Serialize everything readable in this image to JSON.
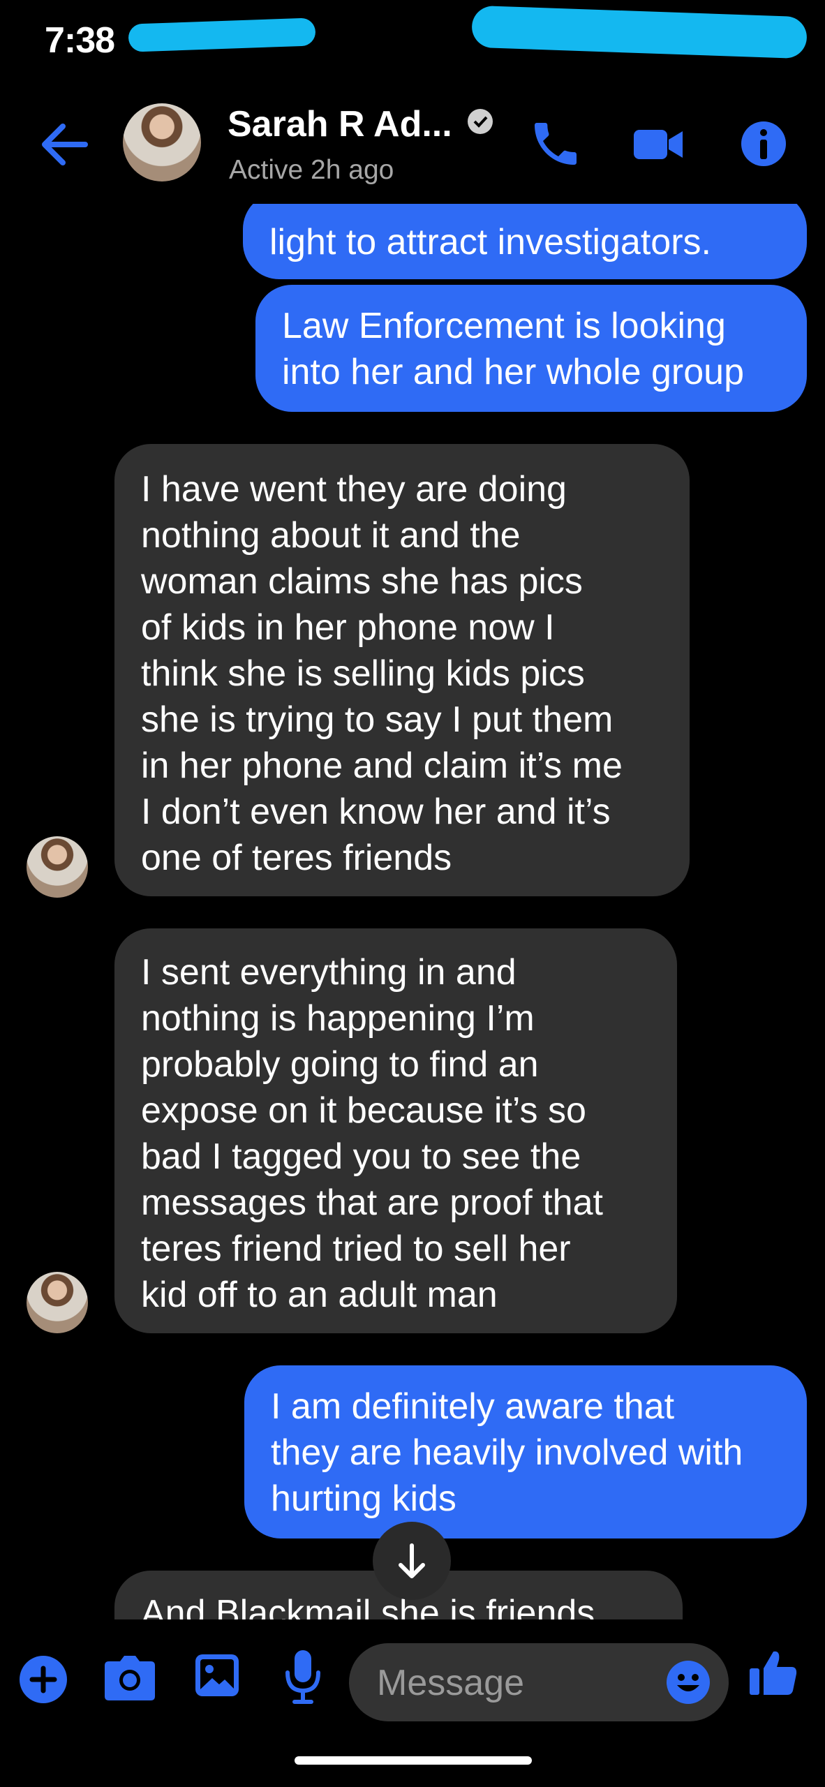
{
  "status_bar": {
    "time": "7:38"
  },
  "header": {
    "contact_name": "Sarah R Ad...",
    "status": "Active 2h ago",
    "accent_color": "#2f6bf5"
  },
  "messages": [
    {
      "from": "me",
      "lines": [
        "light to attract investigators."
      ]
    },
    {
      "from": "me",
      "lines": [
        "Law Enforcement is looking",
        "into her and her whole group"
      ]
    },
    {
      "from": "them",
      "lines": [
        "I have went they are doing",
        "nothing about it and the",
        "woman claims she has pics",
        "of kids in her phone now I",
        "think she is selling kids pics",
        "she is trying to say I put them",
        "in her phone and claim it’s me",
        "I don’t even know her and it’s",
        "one of teres friends"
      ]
    },
    {
      "from": "them",
      "lines": [
        "I sent everything in and",
        "nothing is happening I’m",
        "probably going to find an",
        "expose on it because it’s so",
        "bad I tagged you to see the",
        "messages that are proof that",
        "teres friend tried to sell her",
        "kid off to an adult man"
      ]
    },
    {
      "from": "me",
      "lines": [
        "I am definitely aware that",
        "they are heavily involved with",
        "hurting kids"
      ]
    },
    {
      "from": "them",
      "lines": [
        "And Blackmail she is friends"
      ]
    }
  ],
  "composer": {
    "placeholder": "Message"
  },
  "icons": [
    "back-arrow-icon",
    "verified-badge-icon",
    "phone-icon",
    "video-camera-icon",
    "info-icon",
    "arrow-down-icon",
    "plus-icon",
    "camera-icon",
    "gallery-icon",
    "microphone-icon",
    "emoji-icon",
    "thumbs-up-icon"
  ]
}
